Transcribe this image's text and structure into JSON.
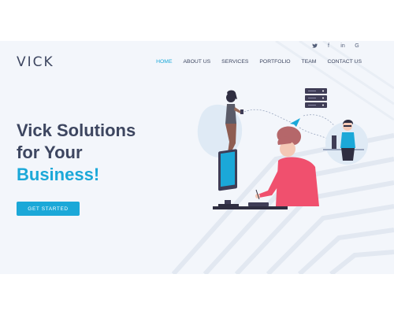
{
  "brand": {
    "logo": "VICK"
  },
  "social": {
    "twitter": "🐦",
    "facebook": "f",
    "linkedin": "in",
    "google": "G"
  },
  "nav": {
    "items": [
      {
        "label": "HOME",
        "active": true
      },
      {
        "label": "ABOUT US",
        "active": false
      },
      {
        "label": "SERVICES",
        "active": false
      },
      {
        "label": "PORTFOLIO",
        "active": false
      },
      {
        "label": "TEAM",
        "active": false
      },
      {
        "label": "CONTACT US",
        "active": false
      }
    ]
  },
  "hero": {
    "line1": "Vick Solutions",
    "line2": "for Your",
    "line3": "Business!",
    "cta": "GET STARTED"
  },
  "colors": {
    "accent": "#1ba8d8",
    "text": "#3d4660",
    "pink": "#f0506e"
  }
}
